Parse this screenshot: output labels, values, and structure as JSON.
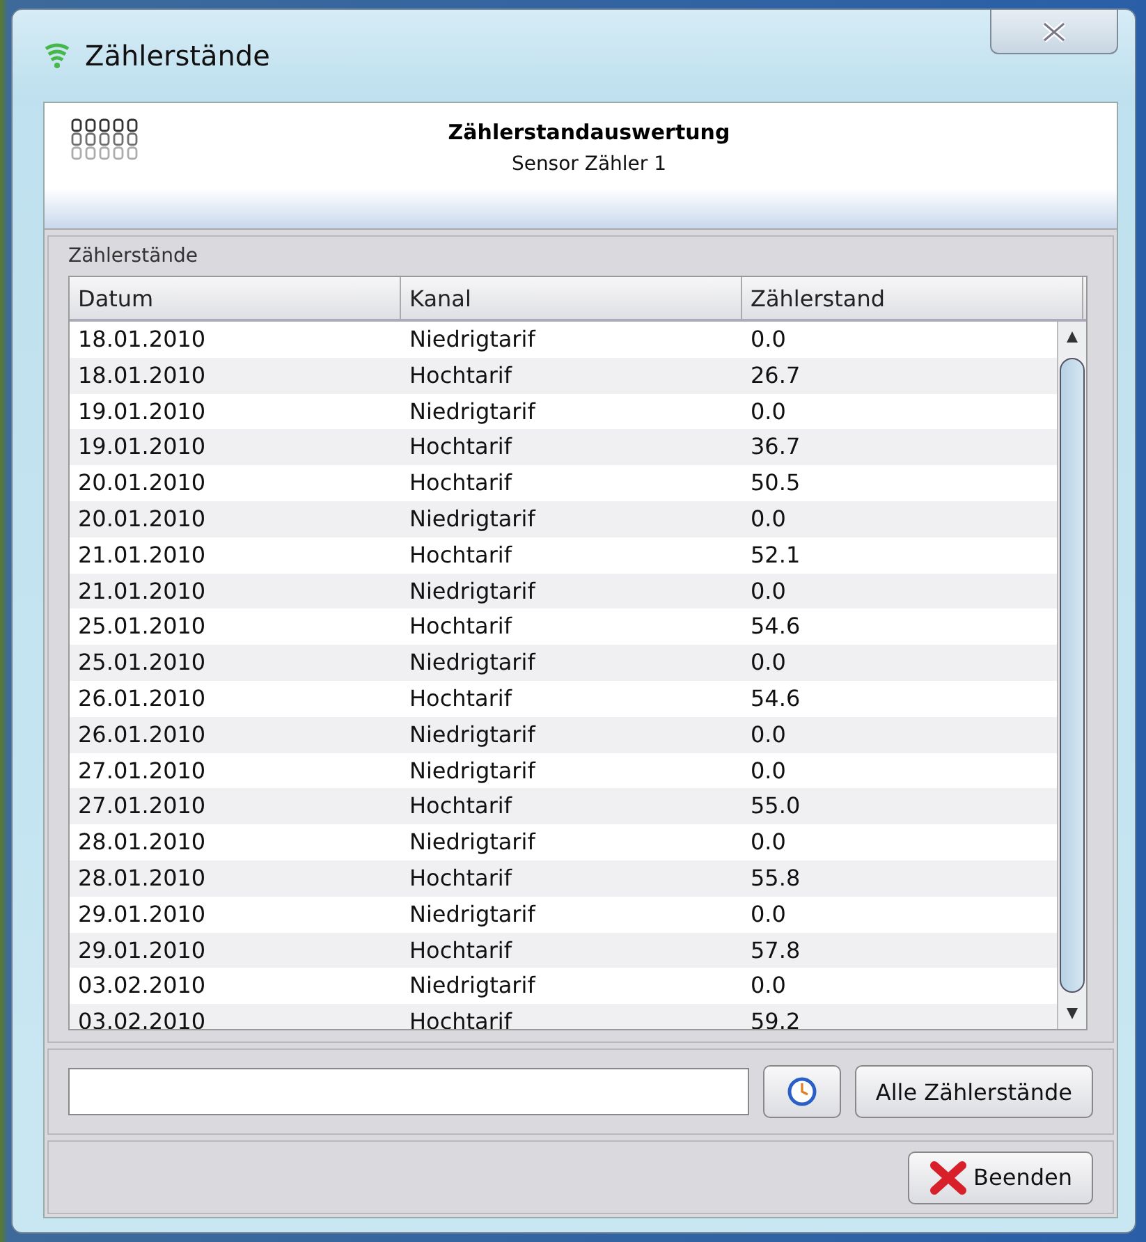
{
  "window": {
    "title": "Zählerstände"
  },
  "header": {
    "title": "Zählerstandauswertung",
    "subtitle": "Sensor Zähler 1"
  },
  "group": {
    "title": "Zählerstände"
  },
  "table": {
    "columns": [
      "Datum",
      "Kanal",
      "Zählerstand"
    ],
    "rows": [
      [
        "18.01.2010",
        "Niedrigtarif",
        "0.0"
      ],
      [
        "18.01.2010",
        "Hochtarif",
        "26.7"
      ],
      [
        "19.01.2010",
        "Niedrigtarif",
        "0.0"
      ],
      [
        "19.01.2010",
        "Hochtarif",
        "36.7"
      ],
      [
        "20.01.2010",
        "Hochtarif",
        "50.5"
      ],
      [
        "20.01.2010",
        "Niedrigtarif",
        "0.0"
      ],
      [
        "21.01.2010",
        "Hochtarif",
        "52.1"
      ],
      [
        "21.01.2010",
        "Niedrigtarif",
        "0.0"
      ],
      [
        "25.01.2010",
        "Hochtarif",
        "54.6"
      ],
      [
        "25.01.2010",
        "Niedrigtarif",
        "0.0"
      ],
      [
        "26.01.2010",
        "Hochtarif",
        "54.6"
      ],
      [
        "26.01.2010",
        "Niedrigtarif",
        "0.0"
      ],
      [
        "27.01.2010",
        "Niedrigtarif",
        "0.0"
      ],
      [
        "27.01.2010",
        "Hochtarif",
        "55.0"
      ],
      [
        "28.01.2010",
        "Niedrigtarif",
        "0.0"
      ],
      [
        "28.01.2010",
        "Hochtarif",
        "55.8"
      ],
      [
        "29.01.2010",
        "Niedrigtarif",
        "0.0"
      ],
      [
        "29.01.2010",
        "Hochtarif",
        "57.8"
      ],
      [
        "03.02.2010",
        "Niedrigtarif",
        "0.0"
      ],
      [
        "03.02.2010",
        "Hochtarif",
        "59.2"
      ]
    ]
  },
  "buttons": {
    "all": "Alle Zählerstände",
    "close": "Beenden"
  }
}
